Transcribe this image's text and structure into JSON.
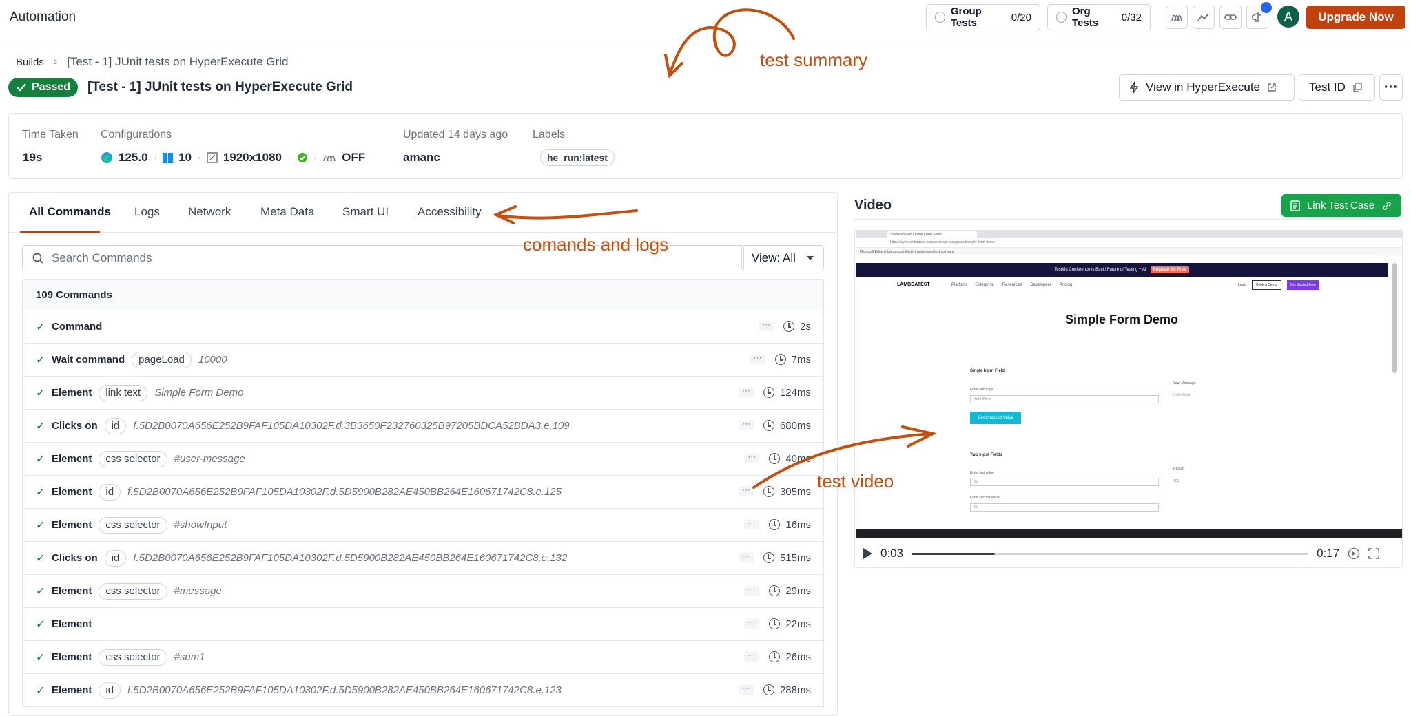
{
  "app": {
    "title": "Automation"
  },
  "topbar": {
    "group_tests": {
      "label": "Group Tests",
      "count": "0/20"
    },
    "org_tests": {
      "label": "Org Tests",
      "count": "0/32"
    },
    "avatar_letter": "A",
    "upgrade_label": "Upgrade Now"
  },
  "breadcrumb": {
    "root": "Builds",
    "current": "[Test - 1] JUnit tests on HyperExecute Grid"
  },
  "header": {
    "status": "Passed",
    "title": "[Test - 1] JUnit tests on HyperExecute Grid",
    "view_btn": "View in HyperExecute",
    "test_id_btn": "Test ID"
  },
  "summary": {
    "time_taken_label": "Time Taken",
    "time_taken": "19s",
    "config_label": "Configurations",
    "browser_version": "125.0",
    "os_version": "10",
    "resolution": "1920x1080",
    "tunnel": "OFF",
    "updated_label": "Updated 14 days ago",
    "updated_by": "amanc",
    "labels_label": "Labels",
    "label_chip": "he_run:latest"
  },
  "tabs": [
    "All Commands",
    "Logs",
    "Network",
    "Meta Data",
    "Smart UI",
    "Accessibility"
  ],
  "search": {
    "placeholder": "Search Commands"
  },
  "view_select": "View: All",
  "commands_count": "109 Commands",
  "commands": [
    {
      "name": "Command",
      "chip": "",
      "arg": "",
      "duration": "2s"
    },
    {
      "name": "Wait command",
      "chip": "pageLoad",
      "arg": "10000",
      "duration": "7ms"
    },
    {
      "name": "Element",
      "chip": "link text",
      "arg": "Simple Form Demo",
      "duration": "124ms"
    },
    {
      "name": "Clicks on",
      "chip": "id",
      "arg": "f.5D2B0070A656E252B9FAF105DA10302F.d.3B3650F232760325B97205BDCA52BDA3.e.109",
      "duration": "680ms"
    },
    {
      "name": "Element",
      "chip": "css selector",
      "arg": "#user-message",
      "duration": "40ms"
    },
    {
      "name": "Element",
      "chip": "id",
      "arg": "f.5D2B0070A656E252B9FAF105DA10302F.d.5D5900B282AE450BB264E160671742C8.e.125",
      "duration": "305ms"
    },
    {
      "name": "Element",
      "chip": "css selector",
      "arg": "#showInput",
      "duration": "16ms"
    },
    {
      "name": "Clicks on",
      "chip": "id",
      "arg": "f.5D2B0070A656E252B9FAF105DA10302F.d.5D5900B282AE450BB264E160671742C8.e.132",
      "duration": "515ms"
    },
    {
      "name": "Element",
      "chip": "css selector",
      "arg": "#message",
      "duration": "29ms"
    },
    {
      "name": "Element",
      "chip": "",
      "arg": "",
      "duration": "22ms"
    },
    {
      "name": "Element",
      "chip": "css selector",
      "arg": "#sum1",
      "duration": "26ms"
    },
    {
      "name": "Element",
      "chip": "id",
      "arg": "f.5D2B0070A656E252B9FAF105DA10302F.d.5D5900B282AE450BB264E160671742C8.e.123",
      "duration": "288ms"
    }
  ],
  "video": {
    "title": "Video",
    "link_btn": "Link Test Case",
    "current_time": "0:03",
    "total_time": "0:17",
    "progress": 0.21,
    "page": {
      "tab_title": "Selenium Grid Online | Run Selen...",
      "url": "https://www.lambdatest.com/selenium-playground/simple-form-demo",
      "notice": "Microsoft Edge is being controlled by automated test software.",
      "promo": "TestMu Conference is Back! Future of Testing + AI",
      "promo_btn": "Register for Free",
      "logo": "LAMBDATEST",
      "menu": [
        "Platform",
        "Enterprise",
        "Resources",
        "Developers",
        "Pricing"
      ],
      "login": "Login",
      "book_demo": "Book a Demo",
      "get_started": "Get Started Free",
      "form_title": "Simple Form Demo",
      "single_input": "Single Input Field",
      "enter_message": "Enter Message",
      "message_value": "Hello World",
      "your_message": "Your Message:",
      "your_message_value": "Hello World",
      "checked_btn": "Get Checked Value",
      "two_inputs": "Two Input Fields",
      "first_label": "Enter first value",
      "first_value": "65",
      "second_label": "Enter second value",
      "second_value": "35",
      "result_label": "Result:",
      "result_value": "100"
    }
  },
  "annotations": {
    "summary": "test summary",
    "commands": "comands and logs",
    "video": "test video"
  },
  "colors": {
    "accent": "#c2410c",
    "success": "#15803d",
    "link_green": "#16a34a",
    "annotation": "#c2500e"
  }
}
